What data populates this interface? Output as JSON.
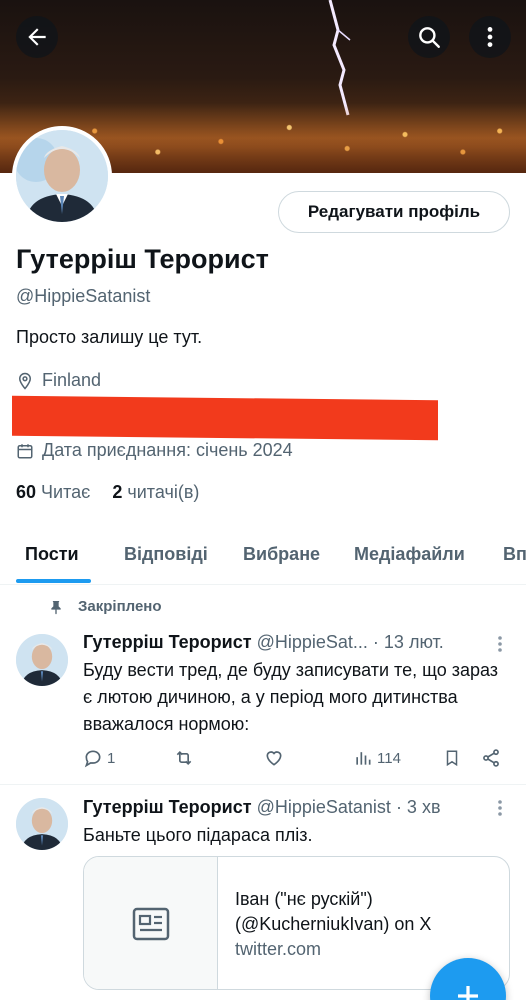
{
  "header": {
    "back_icon": "arrow-left-icon",
    "search_icon": "search-icon",
    "more_icon": "more-vertical-icon"
  },
  "profile": {
    "edit_button_label": "Редагувати профіль",
    "display_name": "Гутерріш Терорист",
    "handle": "@HippieSatanist",
    "bio": "Просто залишу це тут.",
    "location": "Finland",
    "joined": "Дата приєднання: січень 2024",
    "following_count": "60",
    "following_label": "Читає",
    "followers_count": "2",
    "followers_label": "читачі(в)"
  },
  "tabs": [
    "Пости",
    "Відповіді",
    "Вибране",
    "Медіафайли",
    "Вп"
  ],
  "active_tab": "Пости",
  "posts": [
    {
      "pinned_label": "Закріплено",
      "author": "Гутерріш Терорист",
      "handle": "@HippieSat...",
      "time": "· 13 лют.",
      "text": "Буду вести тред, де буду записувати те, що зараз є лютою дичиною, а у період мого дитинства вважалося нормою:",
      "replies": "1",
      "views": "114"
    },
    {
      "author": "Гутерріш Терорист",
      "handle": "@HippieSatanist",
      "time": "· 3 хв",
      "text": "Баньте цього підараса пліз.",
      "card": {
        "title": "Іван (\"нє рускій\") (@KucherniukIvan) on X",
        "domain": "twitter.com"
      }
    }
  ],
  "colors": {
    "accent": "#1d9bf0",
    "redaction": "#f23a1c",
    "muted": "#536471"
  }
}
